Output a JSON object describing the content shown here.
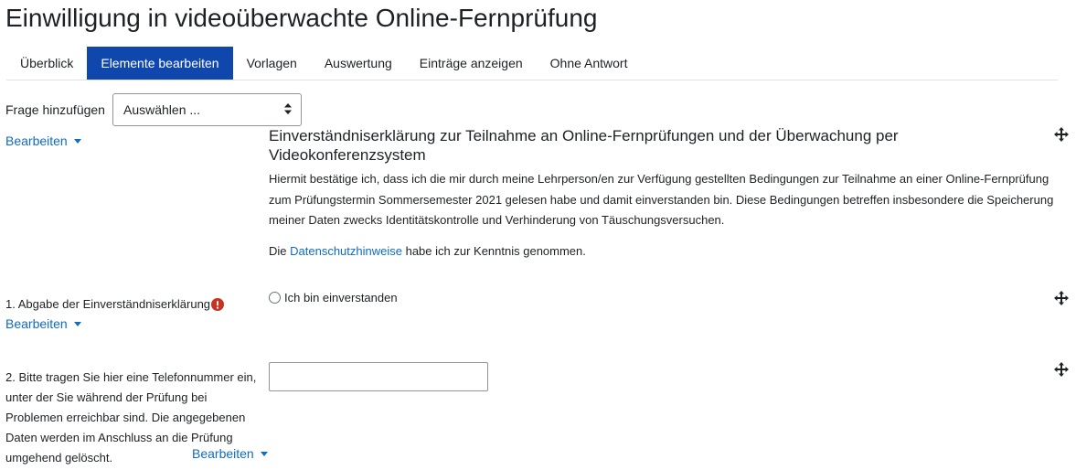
{
  "page_title": "Einwilligung in videoüberwachte Online-Fernprüfung",
  "tabs": [
    {
      "label": "Überblick",
      "active": false
    },
    {
      "label": "Elemente bearbeiten",
      "active": true
    },
    {
      "label": "Vorlagen",
      "active": false
    },
    {
      "label": "Auswertung",
      "active": false
    },
    {
      "label": "Einträge anzeigen",
      "active": false
    },
    {
      "label": "Ohne Antwort",
      "active": false
    }
  ],
  "add_question": {
    "label": "Frage hinzufügen",
    "select_value": "Auswählen ..."
  },
  "items": [
    {
      "edit_label": "Bearbeiten",
      "heading": "Einverständniserklärung zur Teilnahme an Online-Fernprüfungen und der Überwachung per Videokonferenzsystem",
      "description": "Hiermit bestätige ich, dass ich die mir durch meine Lehrperson/en zur Verfügung gestellten Bedingungen zur Teilnahme an einer Online-Fernprüfung zum Prüfungstermin Sommersemester 2021 gelesen habe und damit einverstanden bin. Diese Bedingungen betreffen insbesondere die Speicherung meiner Daten zwecks Identitätskontrolle und Verhinderung von Täuschungsversuchen.",
      "privacy_prefix": "Die ",
      "privacy_link": "Datenschutzhinweise",
      "privacy_suffix": " habe ich zur Kenntnis genommen."
    },
    {
      "label": "1. Abgabe der Einverständniserklärung",
      "required": true,
      "edit_label": "Bearbeiten",
      "radio_label": "Ich bin einverstanden"
    },
    {
      "label": "2. Bitte tragen Sie hier eine Telefonnummer ein, unter der Sie während der Prüfung bei Problemen erreichbar sind. Die angegebenen Daten werden im Anschluss an die Prüfung umgehend gelöscht.",
      "edit_label": "Bearbeiten",
      "input_value": ""
    }
  ],
  "colors": {
    "accent": "#0f47ad",
    "link": "#0f6cbf",
    "required": "#ca3120"
  },
  "icons": {
    "move": "move-arrows-icon",
    "required": "exclamation-circle-icon",
    "select_caret": "up-down-caret-icon",
    "dropdown": "caret-down-icon"
  }
}
